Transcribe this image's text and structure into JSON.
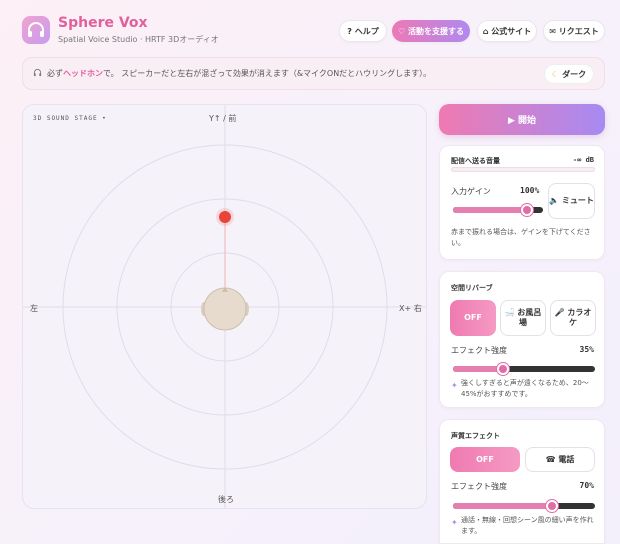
{
  "app": {
    "title": "Sphere Vox",
    "subtitle": "Spatial Voice Studio · HRTF 3Dオーディオ"
  },
  "nav": {
    "help": "? ヘルプ",
    "support": "♡ 活動を支援する",
    "official": "⌂ 公式サイト",
    "request": "✉ リクエスト"
  },
  "notice": {
    "prefix": "必ず",
    "highlight": "ヘッドホン",
    "suffix": "で。 スピーカーだと左右が混ざって効果が消えます（&マイクONだとハウリングします）。",
    "dark_label": "ダーク"
  },
  "stage": {
    "label": "3D SOUND STAGE •",
    "top": "Y↑ / 前",
    "bottom": "後ろ",
    "left": "左",
    "right": "X+ 右"
  },
  "start": {
    "label": "▶ 開始"
  },
  "output": {
    "title": "配信へ送る音量",
    "db": "-∞ dB",
    "input_gain_label": "入力ゲイン",
    "input_gain_value": "100%",
    "input_gain_level": 0.82,
    "mute_label": "🔈 ミュート",
    "hint": "赤まで振れる場合は、ゲインを下げてください。"
  },
  "reverb": {
    "title": "空間リバーブ",
    "off": "OFF",
    "bath": "🛁 お風呂場",
    "karaoke": "🎤 カラオケ",
    "strength_label": "エフェクト強度",
    "strength_value": "35%",
    "strength_level": 0.35,
    "hint": "強くしすぎると声が遠くなるため、20〜45%がおすすめです。"
  },
  "voice": {
    "title": "声質エフェクト",
    "off": "OFF",
    "phone": "☎ 電話",
    "strength_label": "エフェクト強度",
    "strength_value": "70%",
    "strength_level": 0.7,
    "hint": "通話・無線・回想シーン風の細い声を作れます。"
  },
  "colors": {
    "accent": "#e0609e",
    "source_dot": "#e8443a",
    "purple": "#a78af2"
  }
}
